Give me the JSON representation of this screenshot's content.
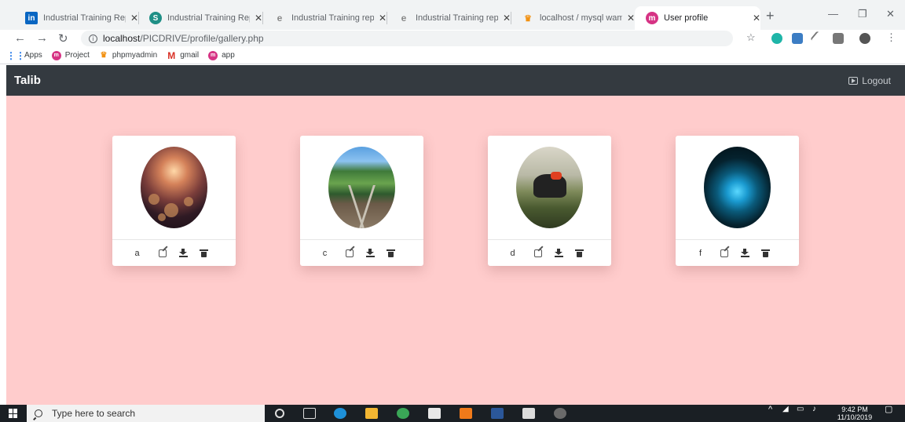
{
  "browser": {
    "tabs": [
      {
        "label": "Industrial Training Repo",
        "icon": "linkedin-icon",
        "active": false
      },
      {
        "label": "Industrial Training Repo",
        "icon": "globe-icon",
        "active": false
      },
      {
        "label": "Industrial Training repo",
        "icon": "doc-icon",
        "active": false
      },
      {
        "label": "Industrial Training repo",
        "icon": "doc-icon",
        "active": false
      },
      {
        "label": "localhost / mysql wamp",
        "icon": "phpmyadmin-icon",
        "active": false
      },
      {
        "label": "User profile",
        "icon": "picdrive-icon",
        "active": true
      }
    ],
    "new_tab_symbol": "+",
    "address": {
      "host": "localhost",
      "path": "/PICDRIVE/profile/gallery.php"
    },
    "bookmarks": [
      {
        "label": "Apps",
        "icon": "apps-grid-icon"
      },
      {
        "label": "Project",
        "icon": "picdrive-icon"
      },
      {
        "label": "phpmyadmin",
        "icon": "phpmyadmin-icon"
      },
      {
        "label": "gmail",
        "icon": "gmail-icon"
      },
      {
        "label": "app",
        "icon": "picdrive-icon"
      }
    ]
  },
  "app": {
    "brand": "Talib",
    "logout_label": "Logout"
  },
  "gallery": {
    "cards": [
      {
        "caption": "a",
        "image": "bokeh-lights-photo"
      },
      {
        "caption": "c",
        "image": "railway-bridge-photo"
      },
      {
        "caption": "d",
        "image": "motorcycle-photo"
      },
      {
        "caption": "f",
        "image": "blue-flower-photo"
      }
    ]
  },
  "taskbar": {
    "search_placeholder": "Type here to search",
    "time": "9:42 PM",
    "date": "11/10/2019"
  },
  "colors": {
    "gallery_bg": "#ffcccc",
    "navbar_bg": "#343a40",
    "card_bg": "#ffffff"
  }
}
